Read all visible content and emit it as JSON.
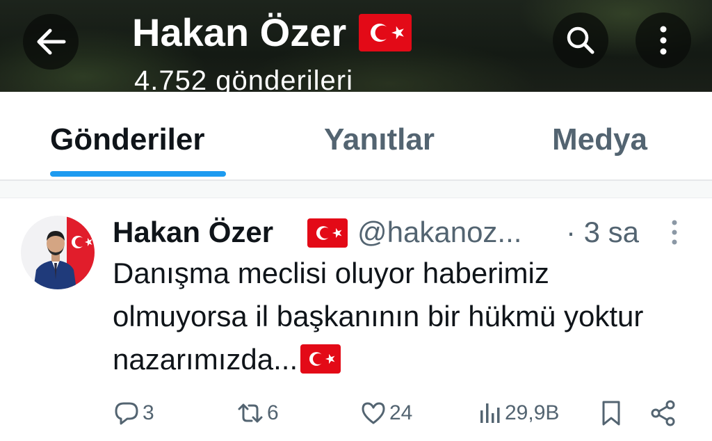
{
  "header": {
    "title": "Hakan Özer",
    "subtitle": "4.752 gönderileri",
    "back_icon": "arrow-left-icon",
    "search_icon": "search-icon",
    "more_icon": "more-vertical-icon"
  },
  "tabs": [
    {
      "label": "Gönderiler",
      "active": true
    },
    {
      "label": "Yanıtlar",
      "active": false
    },
    {
      "label": "Medya",
      "active": false
    }
  ],
  "post": {
    "author_name": "Hakan Özer",
    "handle": "@hakanoz...",
    "time": "· 3 sa",
    "text": "Danışma meclisi oluyor haberimiz olmuyorsa il başkanının bir hükmü yoktur nazarımızda...",
    "actions": {
      "replies": "3",
      "reposts": "6",
      "likes": "24",
      "views": "29,9B"
    }
  },
  "colors": {
    "accent": "#1d9bf0",
    "text_primary": "#0f1419",
    "text_secondary": "#536471",
    "flag_red": "#e30a17"
  }
}
